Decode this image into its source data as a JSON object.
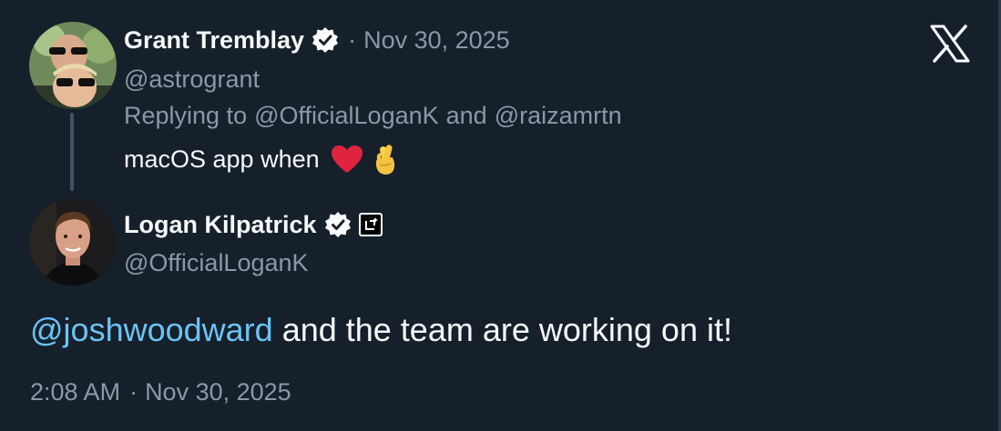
{
  "reply_tweet": {
    "author_name": "Grant Tremblay",
    "separator": "·",
    "date": "Nov 30, 2025",
    "handle": "@astrogrant",
    "replying_prefix": "Replying to",
    "replying_to_1": "@OfficialLoganK",
    "replying_and": "and",
    "replying_to_2": "@raizamrtn",
    "text": "macOS app when",
    "emojis": [
      "red-heart",
      "crossed-fingers"
    ]
  },
  "main_tweet": {
    "author_name": "Logan Kilpatrick",
    "handle": "@OfficialLoganK",
    "mention": "@joshwoodward",
    "text": " and the team are working on it!",
    "time": "2:08 AM",
    "separator": "·",
    "date": "Nov 30, 2025"
  },
  "icons": {
    "brand": "x-logo-icon",
    "verified": "verified-badge-icon",
    "affiliate": "affiliate-badge-icon"
  },
  "colors": {
    "background": "#15202b",
    "text": "#f7f9f9",
    "muted": "#8b98a5",
    "mention": "#6cc3f5",
    "heart": "#e0243f"
  }
}
